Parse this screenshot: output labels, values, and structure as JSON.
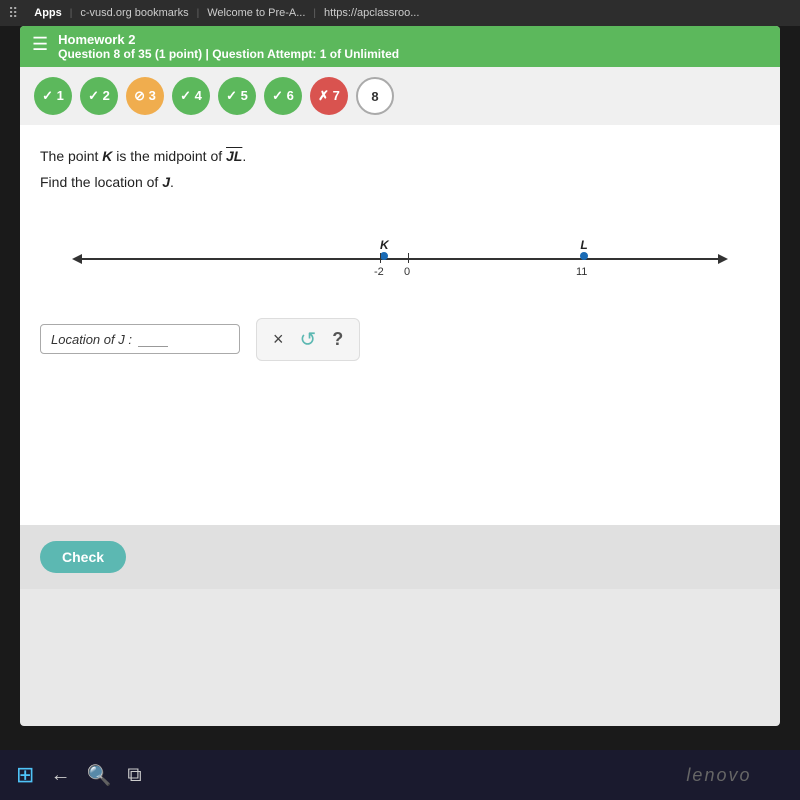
{
  "browser": {
    "tabs": [
      {
        "label": "Apps",
        "active": false
      },
      {
        "label": "c-vusd.org bookmarks",
        "active": false
      },
      {
        "label": "Welcome to Pre-A...",
        "active": false
      },
      {
        "label": "https://apclassroo...",
        "active": true
      }
    ]
  },
  "header": {
    "title": "Homework 2",
    "subtitle": "Question 8 of 35 (1 point)",
    "attempt": "Question Attempt: 1 of Unlimited"
  },
  "bubbles": [
    {
      "number": "1",
      "status": "check",
      "type": "green"
    },
    {
      "number": "2",
      "status": "check",
      "type": "green"
    },
    {
      "number": "3",
      "status": "circle",
      "type": "orange"
    },
    {
      "number": "4",
      "status": "check",
      "type": "green"
    },
    {
      "number": "5",
      "status": "check",
      "type": "green"
    },
    {
      "number": "6",
      "status": "check",
      "type": "green"
    },
    {
      "number": "7",
      "status": "x",
      "type": "red"
    },
    {
      "number": "8",
      "status": "current",
      "type": "outline"
    }
  ],
  "question": {
    "line1": "The point K is the midpoint of JL.",
    "line2": "Find the location of J.",
    "point_K_label": "K",
    "point_K_value": "-2",
    "tick_zero": "0",
    "point_L_label": "L",
    "point_L_value": "11"
  },
  "answer": {
    "label": "Location of J :",
    "placeholder": ""
  },
  "buttons": {
    "clear": "×",
    "undo": "↺",
    "hint": "?",
    "check": "Check"
  }
}
